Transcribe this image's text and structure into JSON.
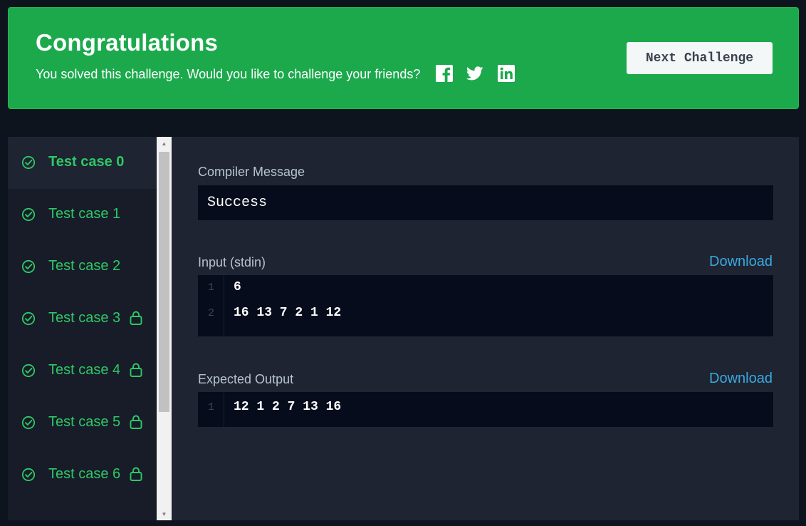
{
  "banner": {
    "title": "Congratulations",
    "subtitle": "You solved this challenge. Would you like to challenge your friends?",
    "next_button": "Next Challenge",
    "social_icons": [
      "facebook-icon",
      "twitter-icon",
      "linkedin-icon"
    ],
    "color": "#1ba94c"
  },
  "test_cases": [
    {
      "label": "Test case 0",
      "active": true,
      "locked": false
    },
    {
      "label": "Test case 1",
      "active": false,
      "locked": false
    },
    {
      "label": "Test case 2",
      "active": false,
      "locked": false
    },
    {
      "label": "Test case 3",
      "active": false,
      "locked": true
    },
    {
      "label": "Test case 4",
      "active": false,
      "locked": true
    },
    {
      "label": "Test case 5",
      "active": false,
      "locked": true
    },
    {
      "label": "Test case 6",
      "active": false,
      "locked": true
    }
  ],
  "compiler": {
    "label": "Compiler Message",
    "message": "Success"
  },
  "input": {
    "label": "Input (stdin)",
    "download": "Download",
    "lines": [
      {
        "num": "1",
        "text": "6"
      },
      {
        "num": "2",
        "text": "16 13 7 2 1 12"
      }
    ]
  },
  "expected": {
    "label": "Expected Output",
    "download": "Download",
    "lines": [
      {
        "num": "1",
        "text": "12 1 2 7 13 16"
      }
    ]
  },
  "colors": {
    "accent_green": "#2ec866",
    "link_blue": "#39a9e0",
    "panel_bg": "#1e2432",
    "code_bg": "#060c1b"
  }
}
